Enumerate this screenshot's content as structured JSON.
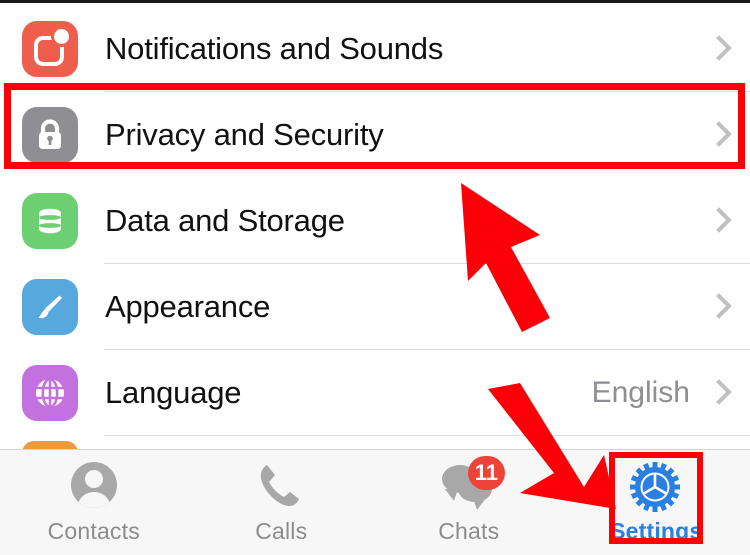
{
  "app": {
    "screen_name": "Settings",
    "platform_style": "ios-messaging-app"
  },
  "settings_list": {
    "rows": [
      {
        "label": "Notifications and Sounds",
        "icon": "bell-notification-icon",
        "icon_color": "#ed5e4c",
        "value": "",
        "chevron": "chevron-right-icon",
        "highlighted": false
      },
      {
        "label": "Privacy and Security",
        "icon": "lock-icon",
        "icon_color": "#8e8e93",
        "value": "",
        "chevron": "chevron-right-icon",
        "highlighted": true
      },
      {
        "label": "Data and Storage",
        "icon": "database-icon",
        "icon_color": "#6cd072",
        "value": "",
        "chevron": "chevron-right-icon",
        "highlighted": false
      },
      {
        "label": "Appearance",
        "icon": "paintbrush-icon",
        "icon_color": "#57a8dd",
        "value": "",
        "chevron": "chevron-right-icon",
        "highlighted": false
      },
      {
        "label": "Language",
        "icon": "globe-icon",
        "icon_color": "#c471e0",
        "value": "English",
        "chevron": "chevron-right-icon",
        "highlighted": false
      }
    ]
  },
  "tabbar": {
    "tabs": [
      {
        "label": "Contacts",
        "icon": "person-circle-icon",
        "active": false,
        "badge": ""
      },
      {
        "label": "Calls",
        "icon": "phone-handset-icon",
        "active": false,
        "badge": ""
      },
      {
        "label": "Chats",
        "icon": "chat-bubbles-icon",
        "active": false,
        "badge": "11"
      },
      {
        "label": "Settings",
        "icon": "gear-icon",
        "active": true,
        "badge": ""
      }
    ]
  },
  "annotations": {
    "highlight_color": "#fb0007",
    "privacy_highlight_target": "Privacy and Security",
    "settings_highlight_target": "Settings",
    "arrows": [
      {
        "name": "arrow-pointing-to-privacy-row",
        "direction": "up-left"
      },
      {
        "name": "arrow-pointing-to-settings-tab",
        "direction": "down-right"
      }
    ]
  }
}
